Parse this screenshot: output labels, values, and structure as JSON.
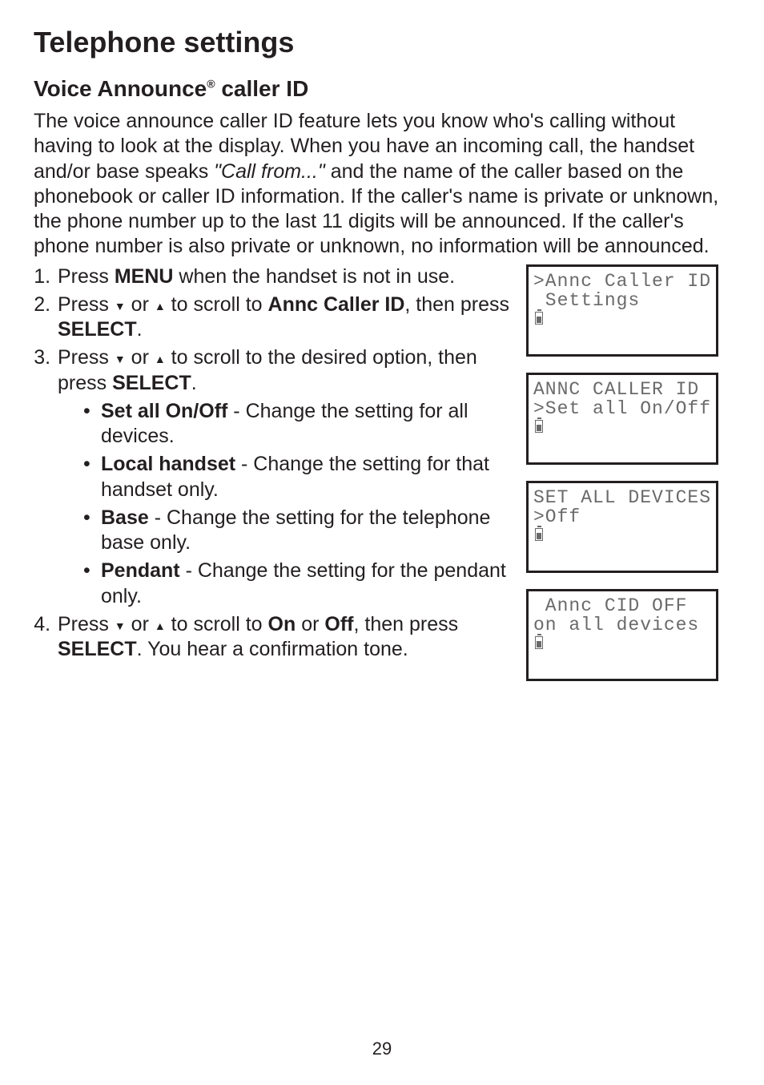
{
  "title": "Telephone settings",
  "subtitle_pre": "Voice Announce",
  "subtitle_sup": "®",
  "subtitle_post": " caller ID",
  "intro": {
    "part1": "The voice announce caller ID feature lets you know who's calling without having to look at the display. When you have an incoming call, the handset and/or base speaks ",
    "quote": "\"Call from...\"",
    "part2": "  and the name of the caller based on the phonebook or caller ID information. If the caller's name is private or unknown, the phone number up to the last 11 digits will be announced. If the caller's phone number is also private or unknown, no information will be announced."
  },
  "steps": {
    "s1a": "Press ",
    "s1b": "MENU",
    "s1c": " when the handset is not in use.",
    "s2a": "Press ",
    "s2b": " or ",
    "s2c": " to scroll to ",
    "s2d": "Annc Caller ID",
    "s2e": ", then press ",
    "s2f": "SELECT",
    "s2g": ".",
    "s3a": "Press ",
    "s3b": " or ",
    "s3c": " to scroll to the desired option, then press ",
    "s3d": "SELECT",
    "s3e": ".",
    "s4a": "Press ",
    "s4b": " or ",
    "s4c": " to scroll to ",
    "s4d": "On",
    "s4e": " or ",
    "s4f": "Off",
    "s4g": ", then press ",
    "s4h": "SELECT",
    "s4i": ". You hear a confirmation tone."
  },
  "options": {
    "o1a": "Set all On/Off",
    "o1b": " - Change the setting for all devices.",
    "o2a": "Local handset",
    "o2b": " - Change the setting for that handset only.",
    "o3a": "Base",
    "o3b": " - Change the setting for the telephone base only.",
    "o4a": "Pendant",
    "o4b": " - Change the setting for the pendant only."
  },
  "screens": [
    {
      "l1": ">Annc Caller ID",
      "l2": " Settings"
    },
    {
      "l1": "ANNC CALLER ID",
      "l2": ">Set all On/Off"
    },
    {
      "l1": "SET ALL DEVICES",
      "l2": ">Off"
    },
    {
      "l1": " Annc CID OFF",
      "l2": "on all devices"
    }
  ],
  "page_number": "29",
  "glyphs": {
    "down": "▼",
    "up": "▲"
  }
}
